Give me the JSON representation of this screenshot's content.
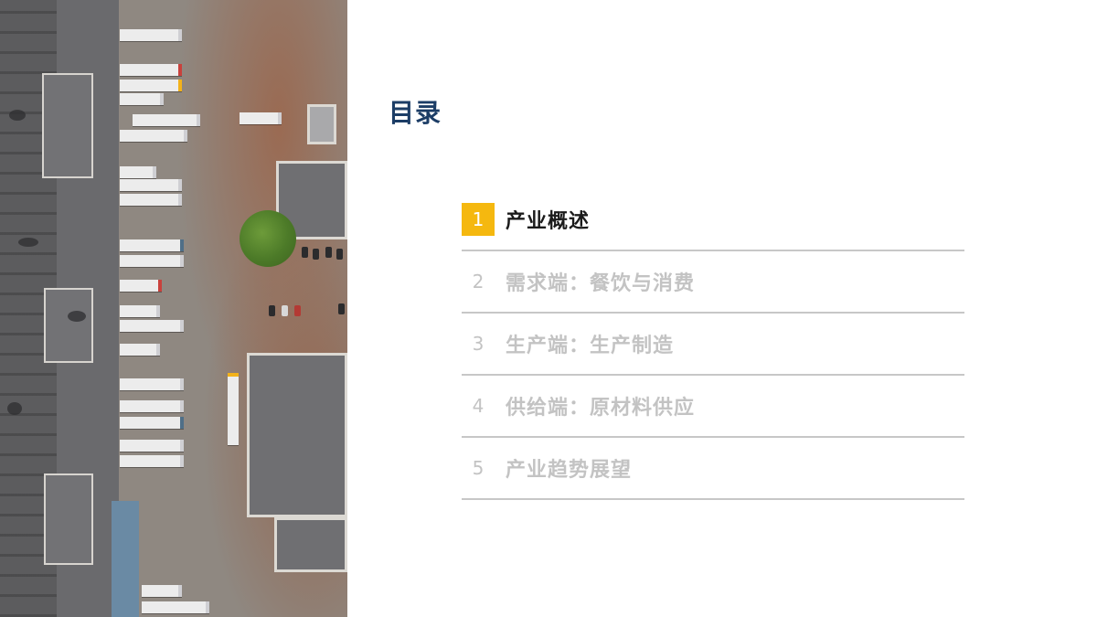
{
  "title": "目录",
  "colors": {
    "accent": "#f5b80f",
    "title": "#1c3d66",
    "inactive": "#c3c3c3",
    "divider": "#c7c7c7"
  },
  "toc": [
    {
      "number": "1",
      "label": "产业概述",
      "active": true
    },
    {
      "number": "2",
      "label": "需求端：餐饮与消费",
      "active": false
    },
    {
      "number": "3",
      "label": "生产端：生产制造",
      "active": false
    },
    {
      "number": "4",
      "label": "供给端：原材料供应",
      "active": false
    },
    {
      "number": "5",
      "label": "产业趋势展望",
      "active": false
    }
  ]
}
